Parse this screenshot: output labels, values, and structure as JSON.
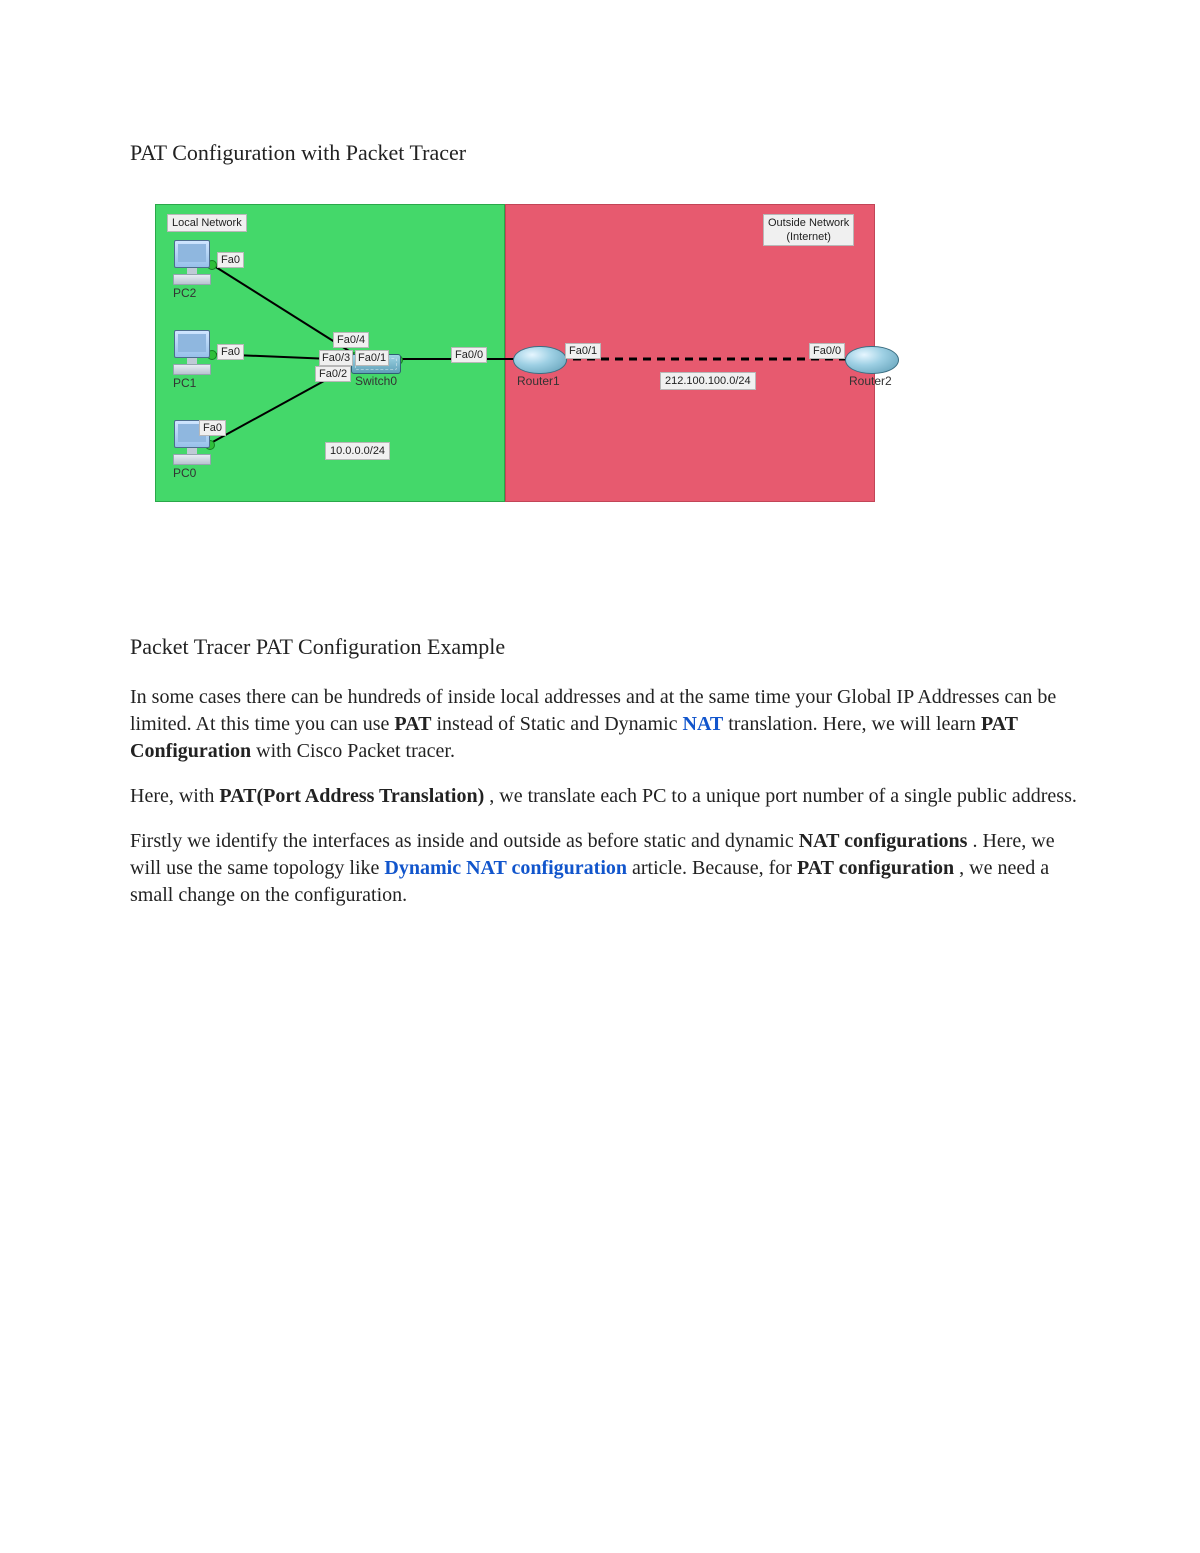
{
  "document": {
    "title": "PAT Configuration with Packet Tracer",
    "section_title": "Packet Tracer PAT Configuration Example",
    "para1_a": "In some cases there can be hundreds of inside local addresses and at the same time your Global IP Addresses can be limited. At this time you can use ",
    "pat": "PAT",
    "para1_b": " instead of Static and Dynamic ",
    "nat_link": "NAT",
    "para1_c": " translation. Here, we will learn ",
    "pat_config": "PAT Configuration",
    "para1_d": " with Cisco Packet tracer.",
    "para2_a": "Here, with ",
    "pat_full": "PAT(Port Address Translation)",
    "para2_b": ", we translate each PC to a unique port number of a single public address.",
    "para3_a": "Firstly we identify the interfaces as inside and outside as before static and dynamic ",
    "nat_conf_bold": "NAT configurations",
    "para3_b": ". Here, we will use the same topology like ",
    "dyn_link": "Dynamic NAT configuration",
    "para3_c": " article. Because, for ",
    "pat_conf_bold": "PAT configuration",
    "para3_d": ", we need a small change on the configuration."
  },
  "diagram": {
    "zones": {
      "local": "Local Network",
      "outside": "Outside Network\n(Internet)"
    },
    "devices": {
      "pc2": "PC2",
      "pc1": "PC1",
      "pc0": "PC0",
      "switch0": "Switch0",
      "router1": "Router1",
      "router2": "Router2"
    },
    "subnets": {
      "inside": "10.0.0.0/24",
      "wan": "212.100.100.0/24"
    },
    "interfaces": {
      "pc2_fa0": "Fa0",
      "pc1_fa0": "Fa0",
      "pc0_fa0": "Fa0",
      "sw_fa04": "Fa0/4",
      "sw_fa03": "Fa0/3",
      "sw_fa01": "Fa0/1",
      "sw_fa02": "Fa0/2",
      "r1_fa00": "Fa0/0",
      "r1_fa01": "Fa0/1",
      "r2_fa00": "Fa0/0"
    }
  }
}
